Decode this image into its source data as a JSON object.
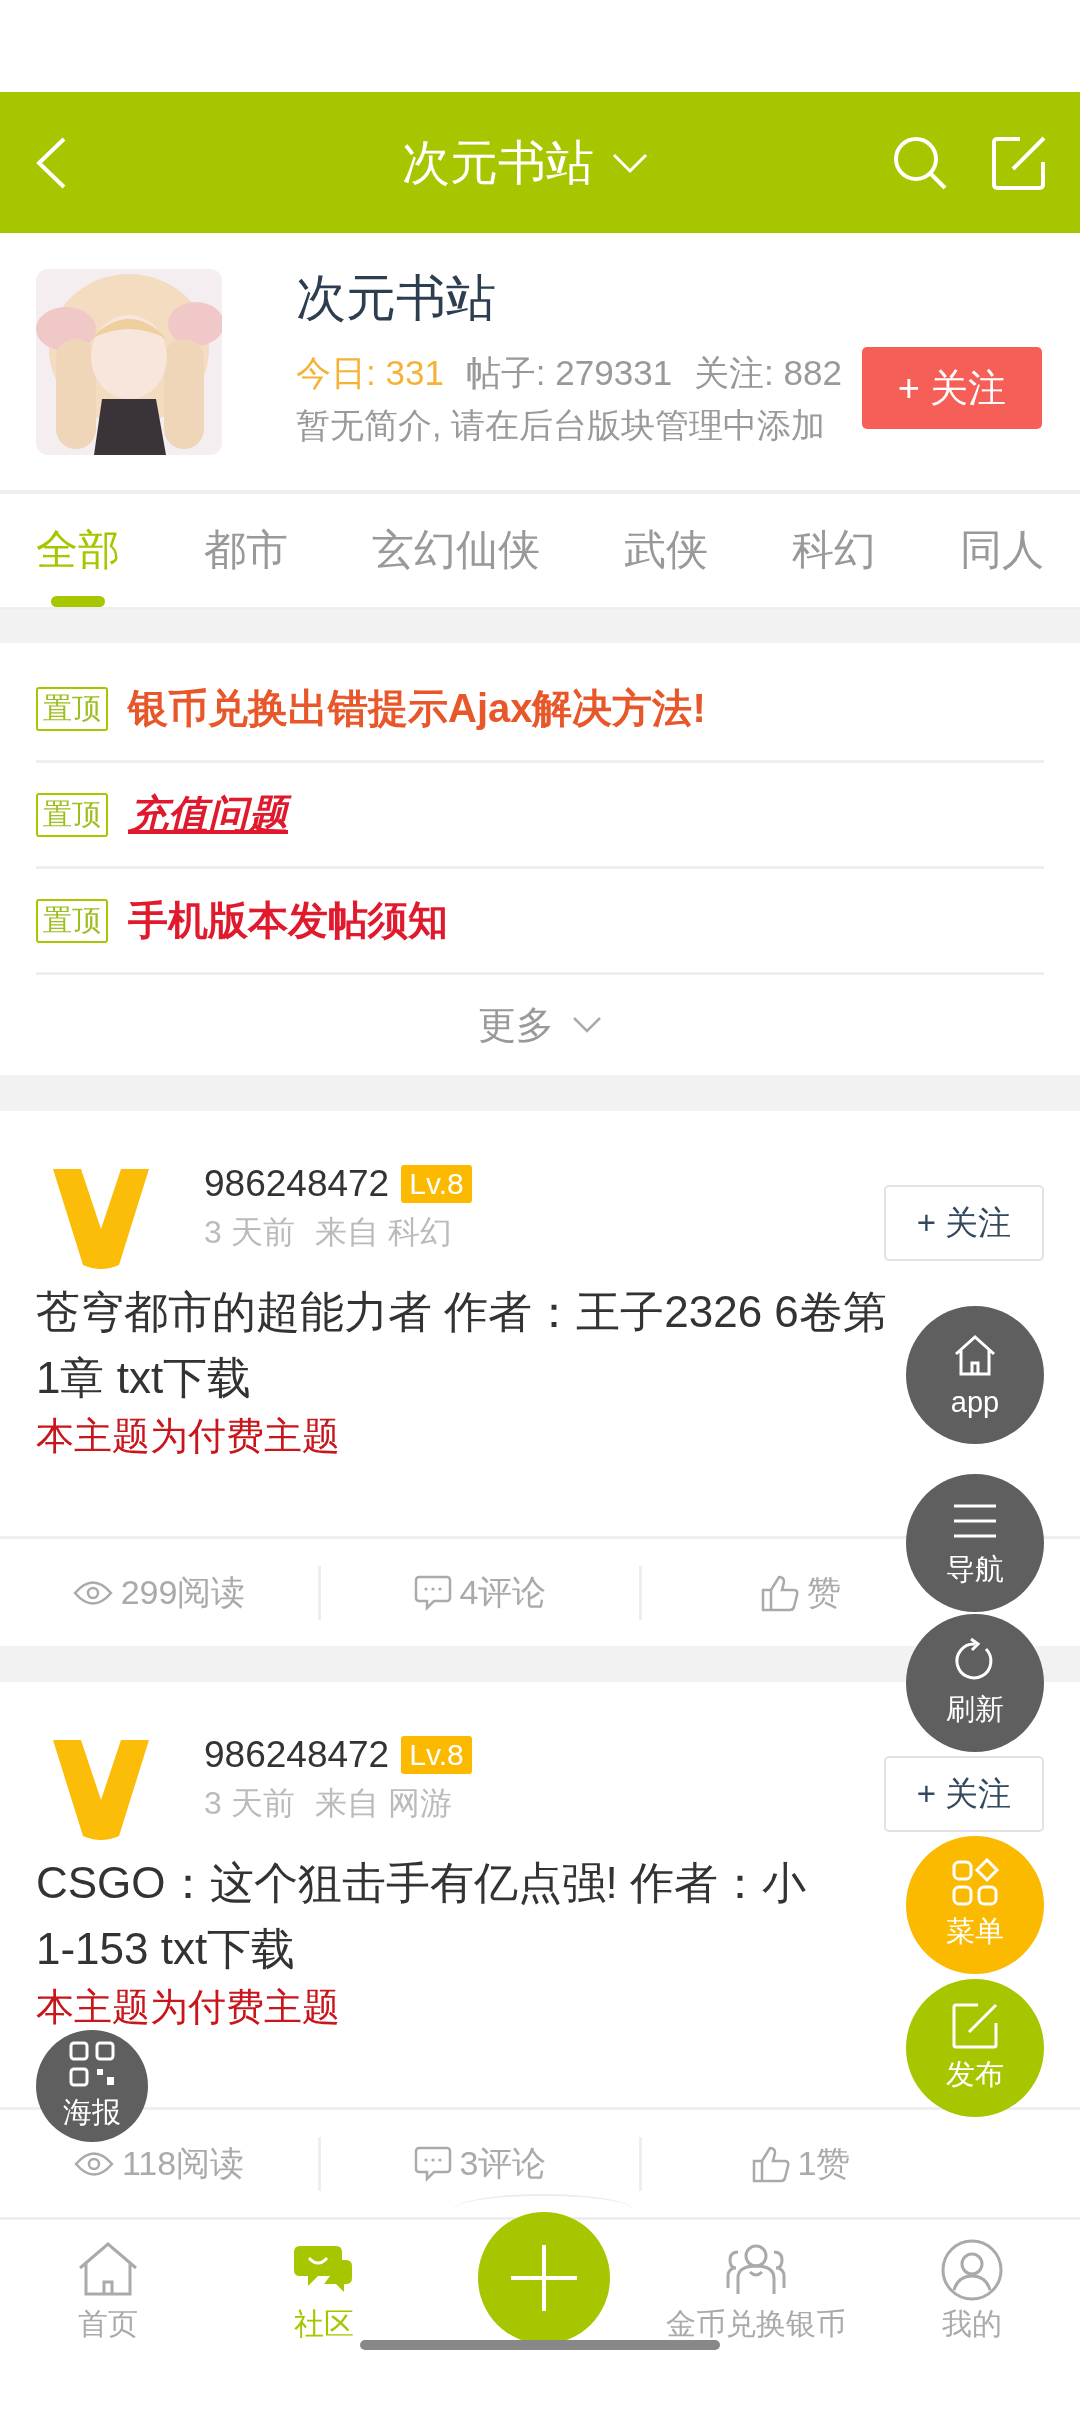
{
  "header": {
    "title": "次元书站"
  },
  "forum": {
    "name": "次元书站",
    "today": "今日: 331",
    "posts": "帖子: 279331",
    "follows": "关注: 882",
    "description": "暂无简介, 请在后台版块管理中添加",
    "follow_button": "+ 关注"
  },
  "tabs": [
    {
      "label": "全部",
      "selected": true
    },
    {
      "label": "都市",
      "selected": false
    },
    {
      "label": "玄幻仙侠",
      "selected": false
    },
    {
      "label": "武侠",
      "selected": false
    },
    {
      "label": "科幻",
      "selected": false
    },
    {
      "label": "同人",
      "selected": false
    }
  ],
  "pinned": [
    {
      "tag": "置顶",
      "title": "银币兑换出错提示Ajax解决方法!",
      "kind": "bold",
      "color": "#e8572a"
    },
    {
      "tag": "置顶",
      "title": "充值问题",
      "kind": "emphasized",
      "color": "#e0192d"
    },
    {
      "tag": "置顶",
      "title": "手机版本发帖须知",
      "kind": "bold",
      "color": "#e0192d"
    }
  ],
  "more": "更多",
  "posts": [
    {
      "user": "986248472",
      "level": "Lv.8",
      "time": "3 天前",
      "source": "来自 科幻",
      "follow_button": "+ 关注",
      "title_lines": [
        "苍穹都市的超能力者 作者：王子2326 6卷第",
        "1章 txt下载"
      ],
      "notice": "本主题为付费主题",
      "reads": "299阅读",
      "comments": "4评论",
      "likes": "赞"
    },
    {
      "user": "986248472",
      "level": "Lv.8",
      "time": "3 天前",
      "source": "来自 网游",
      "follow_button": "+ 关注",
      "title_lines": [
        "CSGO：这个狙击手有亿点强! 作者：小",
        "1-153 txt下载"
      ],
      "notice": "本主题为付费主题",
      "reads": "118阅读",
      "comments": "3评论",
      "likes": "1赞"
    }
  ],
  "floating_buttons": [
    {
      "label": "app",
      "kind": "home",
      "color": "#5f5f5f"
    },
    {
      "label": "导航",
      "kind": "menu",
      "color": "#5f5f5f"
    },
    {
      "label": "刷新",
      "kind": "refresh",
      "color": "#5f5f5f"
    },
    {
      "label": "菜单",
      "kind": "grid",
      "color": "#fbb900"
    },
    {
      "label": "海报",
      "kind": "qr",
      "color": "#5f5f5f"
    },
    {
      "label": "发布",
      "kind": "edit",
      "color": "#a8c600"
    }
  ],
  "bottom_nav": [
    {
      "label": "首页",
      "kind": "home",
      "selected": false
    },
    {
      "label": "社区",
      "kind": "chat",
      "selected": true
    },
    {
      "kind": "plus"
    },
    {
      "label": "金币兑换银币",
      "kind": "group",
      "selected": false
    },
    {
      "label": "我的",
      "kind": "person",
      "selected": false
    }
  ]
}
